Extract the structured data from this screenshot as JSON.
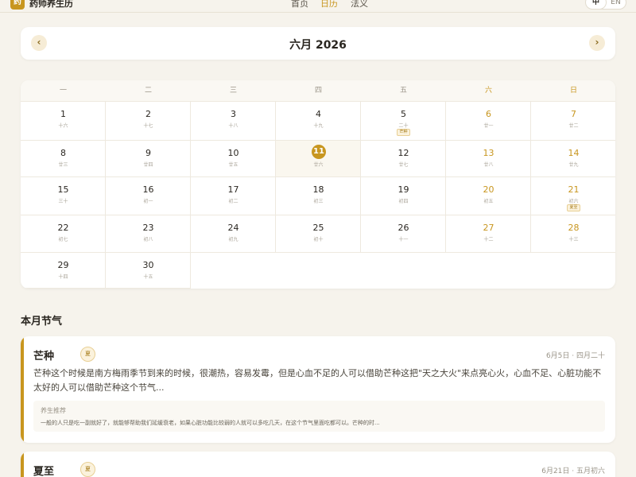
{
  "nav": {
    "logo_char": "药",
    "app_title": "药师养生历",
    "links": [
      "首页",
      "日历",
      "法义"
    ],
    "active_index": 1,
    "lang": [
      "中",
      "EN"
    ],
    "active_lang": 0
  },
  "calendar": {
    "month_title": "六月 2026",
    "prev_icon": "‹",
    "next_icon": "›",
    "weekdays": [
      "一",
      "二",
      "三",
      "四",
      "五",
      "六",
      "日"
    ],
    "weeks": [
      [
        {
          "day": "1",
          "lunar": "十六"
        },
        {
          "day": "2",
          "lunar": "十七"
        },
        {
          "day": "3",
          "lunar": "十八"
        },
        {
          "day": "4",
          "lunar": "十九"
        },
        {
          "day": "5",
          "lunar": "二十",
          "term": "芒种"
        },
        {
          "day": "6",
          "lunar": "廿一"
        },
        {
          "day": "7",
          "lunar": "廿二"
        }
      ],
      [
        {
          "day": "8",
          "lunar": "廿三"
        },
        {
          "day": "9",
          "lunar": "廿四"
        },
        {
          "day": "10",
          "lunar": "廿五"
        },
        {
          "day": "11",
          "lunar": "廿六",
          "today": true
        },
        {
          "day": "12",
          "lunar": "廿七"
        },
        {
          "day": "13",
          "lunar": "廿八"
        },
        {
          "day": "14",
          "lunar": "廿九"
        }
      ],
      [
        {
          "day": "15",
          "lunar": "三十"
        },
        {
          "day": "16",
          "lunar": "初一"
        },
        {
          "day": "17",
          "lunar": "初二"
        },
        {
          "day": "18",
          "lunar": "初三"
        },
        {
          "day": "19",
          "lunar": "初四"
        },
        {
          "day": "20",
          "lunar": "初五"
        },
        {
          "day": "21",
          "lunar": "初六",
          "term": "夏至"
        }
      ],
      [
        {
          "day": "22",
          "lunar": "初七"
        },
        {
          "day": "23",
          "lunar": "初八"
        },
        {
          "day": "24",
          "lunar": "初九"
        },
        {
          "day": "25",
          "lunar": "初十"
        },
        {
          "day": "26",
          "lunar": "十一"
        },
        {
          "day": "27",
          "lunar": "十二"
        },
        {
          "day": "28",
          "lunar": "十三"
        }
      ],
      [
        {
          "day": "29",
          "lunar": "十四"
        },
        {
          "day": "30",
          "lunar": "十五"
        }
      ]
    ]
  },
  "solar_terms": {
    "section_title": "本月节气",
    "items": [
      {
        "name": "芒种",
        "season": "夏",
        "date": "6月5日 · 四月二十",
        "desc": "芒种这个时候是南方梅雨季节到来的时候，很潮热，容易发霉，但是心血不足的人可以借助芒种这把\"天之大火\"来点亮心火，心血不足、心脏功能不太好的人可以借助芒种这个节气...",
        "tip_label": "养生推荐",
        "tip_text": "一般的人只是吃一副就好了，就能够帮助我们延缓衰老，如果心脏功能比较弱的人就可以多吃几天，在这个节气里面吃都可以。芒种的时..."
      },
      {
        "name": "夏至",
        "season": "夏",
        "date": "6月21日 · 五月初六"
      }
    ]
  },
  "colors": {
    "accent": "#c8961f",
    "background": "#f6f3ec",
    "card": "#ffffff"
  }
}
